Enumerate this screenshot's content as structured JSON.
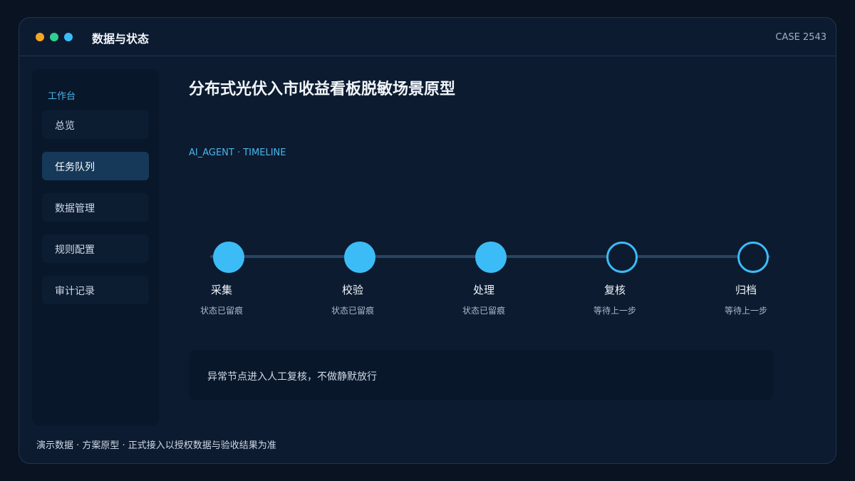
{
  "window": {
    "title": "数据与状态",
    "case_id": "CASE 2543",
    "traffic_lights": [
      "#f5a524",
      "#2fd08f",
      "#38bdf8"
    ]
  },
  "sidebar": {
    "heading": "工作台",
    "items": [
      {
        "label": "总览",
        "active": false
      },
      {
        "label": "任务队列",
        "active": true
      },
      {
        "label": "数据管理",
        "active": false
      },
      {
        "label": "规则配置",
        "active": false
      },
      {
        "label": "审计记录",
        "active": false
      }
    ]
  },
  "main": {
    "title": "分布式光伏入市收益看板脱敏场景原型",
    "subtitle": "AI_AGENT · TIMELINE",
    "accent_color": "#3cbcf6",
    "steps": [
      {
        "label": "采集",
        "status": "状态已留痕",
        "state": "done"
      },
      {
        "label": "校验",
        "status": "状态已留痕",
        "state": "done"
      },
      {
        "label": "处理",
        "status": "状态已留痕",
        "state": "done"
      },
      {
        "label": "复核",
        "status": "等待上一步",
        "state": "pending"
      },
      {
        "label": "归档",
        "status": "等待上一步",
        "state": "pending"
      }
    ],
    "notice": "异常节点进入人工复核，不做静默放行"
  },
  "footer": {
    "text": "演示数据 · 方案原型 · 正式接入以授权数据与验收结果为准"
  }
}
